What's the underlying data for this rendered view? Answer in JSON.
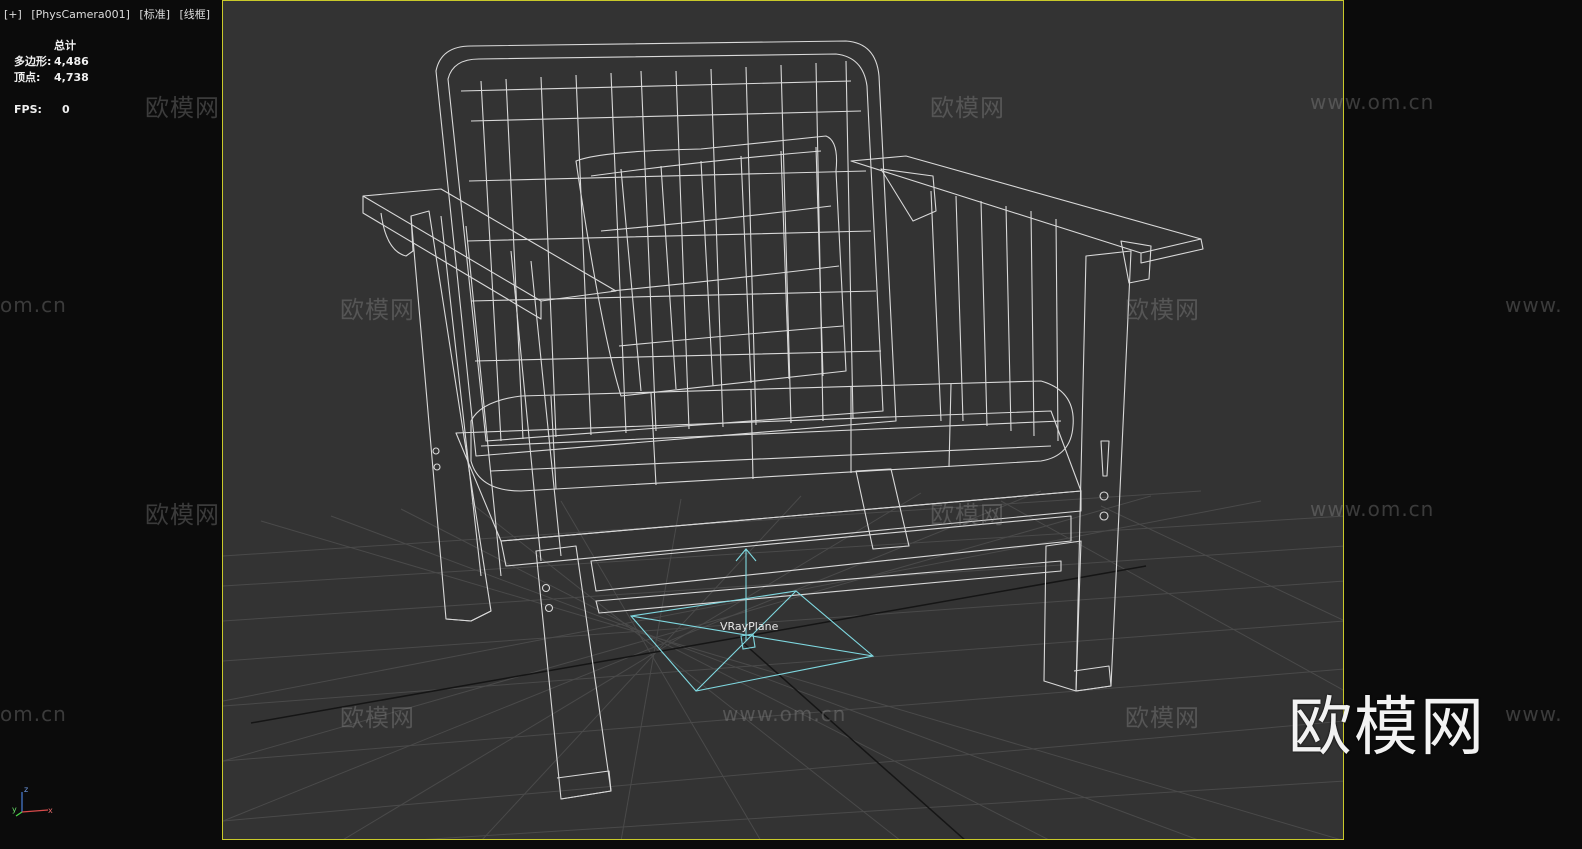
{
  "viewport": {
    "labels": [
      "[+]",
      "[PhysCamera001]",
      "[标准]",
      "[线框]"
    ]
  },
  "stats": {
    "header": "总计",
    "polygons_label": "多边形:",
    "polygons_value": "4,486",
    "vertices_label": "顶点:",
    "vertices_value": "4,738",
    "fps_label": "FPS:",
    "fps_value": "0"
  },
  "scene": {
    "object_label": "VRayPlane",
    "grid_color": "#4a4a4a",
    "wire_color": "#d9d9d9",
    "helper_color": "#7fd8e0",
    "frame_color": "#c9c92a"
  },
  "watermarks": {
    "cn": "欧模网",
    "url": "www.om.cn",
    "partial_url": "om.cn",
    "partial_url_right": "www."
  },
  "brand": {
    "logo_text": "欧模网"
  },
  "gizmo": {
    "z": "z",
    "x": "x",
    "y": "y"
  }
}
